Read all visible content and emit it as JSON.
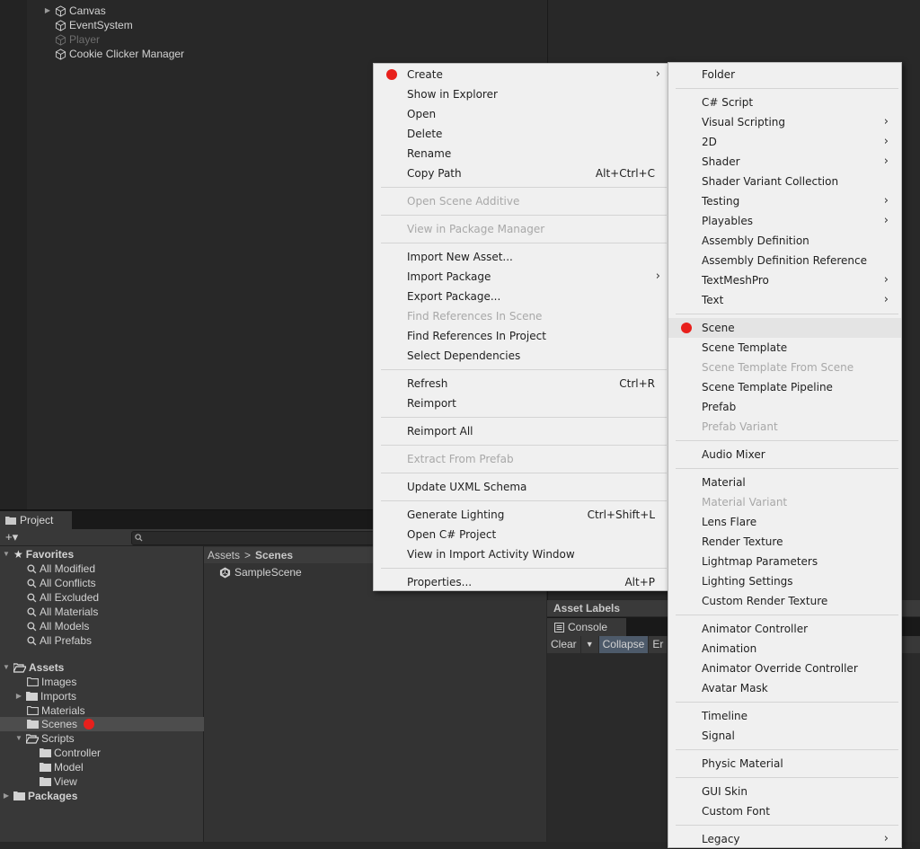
{
  "hierarchy": {
    "items": [
      {
        "label": "Canvas",
        "arrow": true,
        "dim": false
      },
      {
        "label": "EventSystem",
        "arrow": false,
        "dim": false
      },
      {
        "label": "Player",
        "arrow": false,
        "dim": true
      },
      {
        "label": "Cookie Clicker Manager",
        "arrow": false,
        "dim": false
      }
    ]
  },
  "project": {
    "tab_label": "Project",
    "add_label": "+▾",
    "breadcrumb": {
      "root": "Assets",
      "separator": ">",
      "current": "Scenes"
    },
    "favorites_label": "Favorites",
    "favorites": [
      "All Modified",
      "All Conflicts",
      "All Excluded",
      "All Materials",
      "All Models",
      "All Prefabs"
    ],
    "assets_label": "Assets",
    "folders": [
      "Images",
      "Imports",
      "Materials",
      "Scenes",
      "Scripts",
      "Controller",
      "Model",
      "View"
    ],
    "packages_label": "Packages",
    "scene_file": "SampleScene"
  },
  "inspector": {
    "asset_labels": "Asset Labels"
  },
  "console": {
    "tab_label": "Console",
    "clear": "Clear",
    "collapse": "Collapse",
    "error_truncated": "Er"
  },
  "context_menu": {
    "items": [
      {
        "label": "Create",
        "shortcut": "",
        "submenu": true,
        "disabled": false,
        "marker": true
      },
      {
        "label": "Show in Explorer",
        "shortcut": "",
        "submenu": false,
        "disabled": false
      },
      {
        "label": "Open",
        "shortcut": "",
        "submenu": false,
        "disabled": false
      },
      {
        "label": "Delete",
        "shortcut": "",
        "submenu": false,
        "disabled": false
      },
      {
        "label": "Rename",
        "shortcut": "",
        "submenu": false,
        "disabled": false
      },
      {
        "label": "Copy Path",
        "shortcut": "Alt+Ctrl+C",
        "submenu": false,
        "disabled": false
      },
      {
        "label": "Open Scene Additive",
        "shortcut": "",
        "submenu": false,
        "disabled": true
      },
      {
        "label": "View in Package Manager",
        "shortcut": "",
        "submenu": false,
        "disabled": true
      },
      {
        "label": "Import New Asset...",
        "shortcut": "",
        "submenu": false,
        "disabled": false
      },
      {
        "label": "Import Package",
        "shortcut": "",
        "submenu": true,
        "disabled": false
      },
      {
        "label": "Export Package...",
        "shortcut": "",
        "submenu": false,
        "disabled": false
      },
      {
        "label": "Find References In Scene",
        "shortcut": "",
        "submenu": false,
        "disabled": true
      },
      {
        "label": "Find References In Project",
        "shortcut": "",
        "submenu": false,
        "disabled": false
      },
      {
        "label": "Select Dependencies",
        "shortcut": "",
        "submenu": false,
        "disabled": false
      },
      {
        "label": "Refresh",
        "shortcut": "Ctrl+R",
        "submenu": false,
        "disabled": false
      },
      {
        "label": "Reimport",
        "shortcut": "",
        "submenu": false,
        "disabled": false
      },
      {
        "label": "Reimport All",
        "shortcut": "",
        "submenu": false,
        "disabled": false
      },
      {
        "label": "Extract From Prefab",
        "shortcut": "",
        "submenu": false,
        "disabled": true
      },
      {
        "label": "Update UXML Schema",
        "shortcut": "",
        "submenu": false,
        "disabled": false
      },
      {
        "label": "Generate Lighting",
        "shortcut": "Ctrl+Shift+L",
        "submenu": false,
        "disabled": false
      },
      {
        "label": "Open C# Project",
        "shortcut": "",
        "submenu": false,
        "disabled": false
      },
      {
        "label": "View in Import Activity Window",
        "shortcut": "",
        "submenu": false,
        "disabled": false
      },
      {
        "label": "Properties...",
        "shortcut": "Alt+P",
        "submenu": false,
        "disabled": false
      }
    ]
  },
  "create_submenu": {
    "items": [
      {
        "label": "Folder",
        "submenu": false,
        "disabled": false
      },
      {
        "label": "C# Script",
        "submenu": false,
        "disabled": false
      },
      {
        "label": "Visual Scripting",
        "submenu": true,
        "disabled": false
      },
      {
        "label": "2D",
        "submenu": true,
        "disabled": false
      },
      {
        "label": "Shader",
        "submenu": true,
        "disabled": false
      },
      {
        "label": "Shader Variant Collection",
        "submenu": false,
        "disabled": false
      },
      {
        "label": "Testing",
        "submenu": true,
        "disabled": false
      },
      {
        "label": "Playables",
        "submenu": true,
        "disabled": false
      },
      {
        "label": "Assembly Definition",
        "submenu": false,
        "disabled": false
      },
      {
        "label": "Assembly Definition Reference",
        "submenu": false,
        "disabled": false
      },
      {
        "label": "TextMeshPro",
        "submenu": true,
        "disabled": false
      },
      {
        "label": "Text",
        "submenu": true,
        "disabled": false
      },
      {
        "label": "Scene",
        "submenu": false,
        "disabled": false,
        "marker": true,
        "highlighted": true
      },
      {
        "label": "Scene Template",
        "submenu": false,
        "disabled": false
      },
      {
        "label": "Scene Template From Scene",
        "submenu": false,
        "disabled": true
      },
      {
        "label": "Scene Template Pipeline",
        "submenu": false,
        "disabled": false
      },
      {
        "label": "Prefab",
        "submenu": false,
        "disabled": false
      },
      {
        "label": "Prefab Variant",
        "submenu": false,
        "disabled": true
      },
      {
        "label": "Audio Mixer",
        "submenu": false,
        "disabled": false
      },
      {
        "label": "Material",
        "submenu": false,
        "disabled": false
      },
      {
        "label": "Material Variant",
        "submenu": false,
        "disabled": true
      },
      {
        "label": "Lens Flare",
        "submenu": false,
        "disabled": false
      },
      {
        "label": "Render Texture",
        "submenu": false,
        "disabled": false
      },
      {
        "label": "Lightmap Parameters",
        "submenu": false,
        "disabled": false
      },
      {
        "label": "Lighting Settings",
        "submenu": false,
        "disabled": false
      },
      {
        "label": "Custom Render Texture",
        "submenu": false,
        "disabled": false
      },
      {
        "label": "Animator Controller",
        "submenu": false,
        "disabled": false
      },
      {
        "label": "Animation",
        "submenu": false,
        "disabled": false
      },
      {
        "label": "Animator Override Controller",
        "submenu": false,
        "disabled": false
      },
      {
        "label": "Avatar Mask",
        "submenu": false,
        "disabled": false
      },
      {
        "label": "Timeline",
        "submenu": false,
        "disabled": false
      },
      {
        "label": "Signal",
        "submenu": false,
        "disabled": false
      },
      {
        "label": "Physic Material",
        "submenu": false,
        "disabled": false
      },
      {
        "label": "GUI Skin",
        "submenu": false,
        "disabled": false
      },
      {
        "label": "Custom Font",
        "submenu": false,
        "disabled": false
      },
      {
        "label": "Legacy",
        "submenu": true,
        "disabled": false
      }
    ]
  },
  "chevron_glyph": "›",
  "colors": {
    "marker": "#e8201c",
    "menu_bg": "#f0f0f0",
    "editor_bg": "#282828"
  }
}
